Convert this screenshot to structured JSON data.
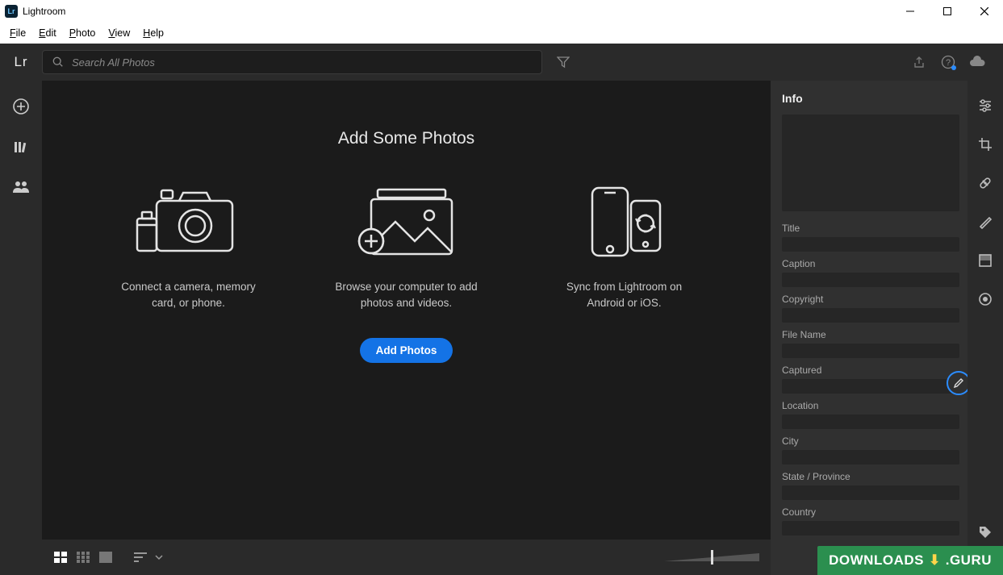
{
  "window": {
    "title": "Lightroom",
    "logo_text": "Lr"
  },
  "menubar": [
    "File",
    "Edit",
    "Photo",
    "View",
    "Help"
  ],
  "topbar": {
    "logo": "Lr",
    "search_placeholder": "Search All Photos"
  },
  "main": {
    "heading": "Add Some Photos",
    "tiles": [
      {
        "caption": "Connect a camera, memory card, or phone."
      },
      {
        "caption": "Browse your computer to add photos and videos."
      },
      {
        "caption": "Sync from Lightroom on Android or iOS."
      }
    ],
    "add_button": "Add Photos"
  },
  "info_panel": {
    "title": "Info",
    "fields": [
      "Title",
      "Caption",
      "Copyright",
      "File Name",
      "Captured",
      "Location",
      "City",
      "State / Province",
      "Country"
    ]
  },
  "watermark": {
    "left": "DOWNLOADS",
    "right": ".GURU"
  },
  "colors": {
    "accent": "#1473e6",
    "ring": "#2b8cff"
  }
}
